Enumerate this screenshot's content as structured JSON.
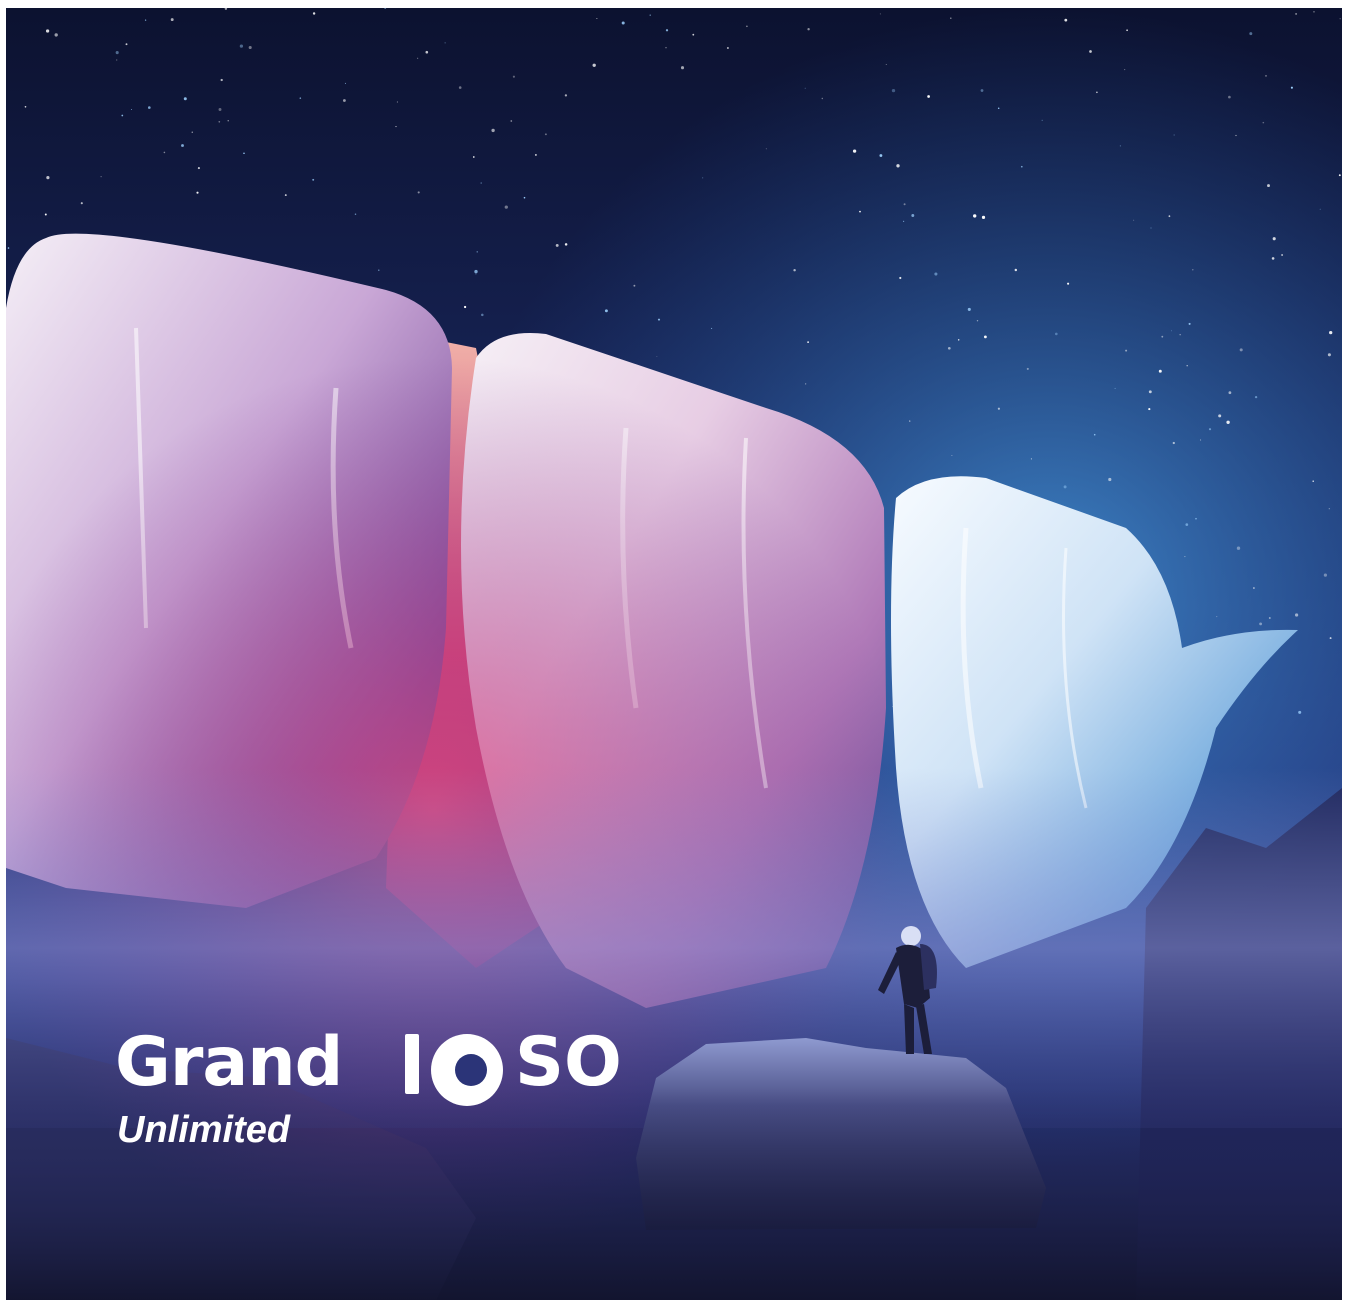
{
  "brand": {
    "word_start": "Grand",
    "word_end": "SO",
    "subtitle": "Unlimited"
  },
  "colors": {
    "sky_top": "#0d1431",
    "sky_mid": "#1d2c66",
    "glow_blue": "#3f8fd6",
    "glow_pink": "#d8477c",
    "rock_dark": "#1e2140",
    "text": "#ffffff"
  }
}
